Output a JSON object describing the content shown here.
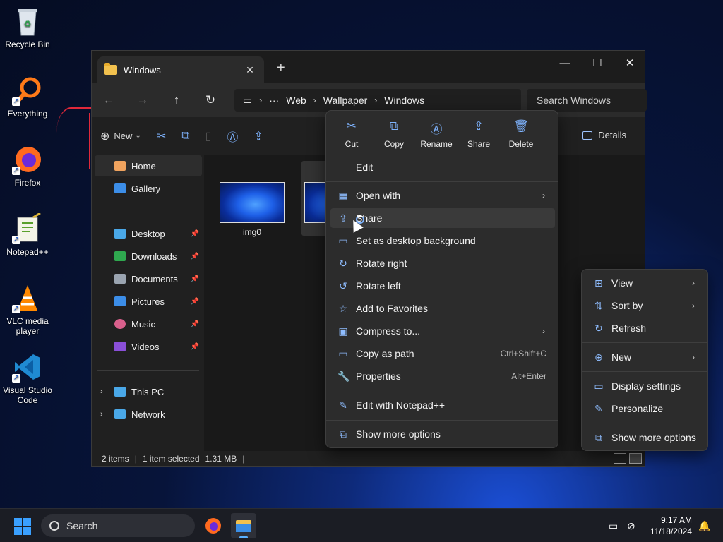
{
  "desktop": {
    "icons": [
      {
        "label": "Recycle Bin"
      },
      {
        "label": "Everything"
      },
      {
        "label": "Firefox"
      },
      {
        "label": "Notepad++"
      },
      {
        "label": "VLC media player"
      },
      {
        "label": "Visual Studio Code"
      }
    ]
  },
  "window": {
    "tab_title": "Windows",
    "new_tab": "+",
    "close_tab": "✕",
    "controls": {
      "minimize": "—",
      "maximize": "☐",
      "close": "✕"
    }
  },
  "nav": {
    "back": "←",
    "forward": "→",
    "up": "↑",
    "refresh": "↻",
    "breadcrumb": [
      "Web",
      "Wallpaper",
      "Windows"
    ],
    "more": "···",
    "search_placeholder": "Search Windows"
  },
  "commandbar": {
    "new_label": "New",
    "details_label": "Details"
  },
  "sidebar": {
    "items": [
      {
        "label": "Home"
      },
      {
        "label": "Gallery"
      },
      {
        "label": "Desktop"
      },
      {
        "label": "Downloads"
      },
      {
        "label": "Documents"
      },
      {
        "label": "Pictures"
      },
      {
        "label": "Music"
      },
      {
        "label": "Videos"
      },
      {
        "label": "This PC"
      },
      {
        "label": "Network"
      }
    ]
  },
  "files": [
    {
      "name": "img0"
    },
    {
      "name": ""
    }
  ],
  "status": {
    "items": "2 items",
    "selected": "1 item selected",
    "size": "1.31 MB"
  },
  "context_menu": {
    "quick_actions": [
      {
        "label": "Cut",
        "icon": "✂"
      },
      {
        "label": "Copy",
        "icon": "⧉"
      },
      {
        "label": "Rename",
        "icon": "Ⓐ"
      },
      {
        "label": "Share",
        "icon": "⇪"
      },
      {
        "label": "Delete",
        "icon": "🗑"
      }
    ],
    "items": [
      {
        "label": "Edit",
        "icon": ""
      },
      {
        "label": "Open with",
        "icon": "▦",
        "arrow": "›"
      },
      {
        "label": "Share",
        "icon": "⇪"
      },
      {
        "label": "Set as desktop background",
        "icon": "▭"
      },
      {
        "label": "Rotate right",
        "icon": "↻"
      },
      {
        "label": "Rotate left",
        "icon": "↺"
      },
      {
        "label": "Add to Favorites",
        "icon": "☆"
      },
      {
        "label": "Compress to...",
        "icon": "▣",
        "arrow": "›"
      },
      {
        "label": "Copy as path",
        "icon": "▭",
        "shortcut": "Ctrl+Shift+C"
      },
      {
        "label": "Properties",
        "icon": "🔧",
        "shortcut": "Alt+Enter"
      },
      {
        "label": "Edit with Notepad++",
        "icon": "✎"
      },
      {
        "label": "Show more options",
        "icon": "⧉"
      }
    ]
  },
  "desktop_menu": {
    "items": [
      {
        "label": "View",
        "icon": "⊞",
        "arrow": "›"
      },
      {
        "label": "Sort by",
        "icon": "⇅",
        "arrow": "›"
      },
      {
        "label": "Refresh",
        "icon": "↻"
      },
      {
        "label": "New",
        "icon": "⊕",
        "arrow": "›"
      },
      {
        "label": "Display settings",
        "icon": "▭"
      },
      {
        "label": "Personalize",
        "icon": "✎"
      },
      {
        "label": "Show more options",
        "icon": "⧉"
      }
    ]
  },
  "taskbar": {
    "search_label": "Search",
    "time": "9:17 AM",
    "date": "11/18/2024"
  },
  "colors": {
    "accent": "#7fb4ff",
    "menu_bg": "#2c2c2c",
    "window_bg": "#202020"
  }
}
